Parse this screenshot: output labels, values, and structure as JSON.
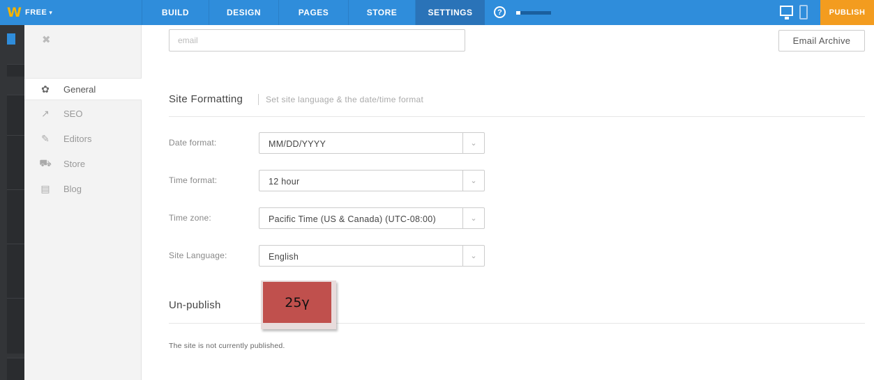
{
  "brand": {
    "logo": "W",
    "plan": "FREE",
    "plan_chevron": "▾"
  },
  "nav": {
    "tabs": [
      {
        "label": "BUILD"
      },
      {
        "label": "DESIGN"
      },
      {
        "label": "PAGES"
      },
      {
        "label": "STORE"
      },
      {
        "label": "SETTINGS",
        "active": true
      }
    ],
    "help_icon": "?",
    "progress_fraction": 0.12,
    "publish_label": "PUBLISH"
  },
  "sidebar": {
    "close_icon": "✖",
    "items": [
      {
        "label": "General",
        "icon": "gear-icon",
        "glyph": "✿",
        "active": true
      },
      {
        "label": "SEO",
        "icon": "trend-icon",
        "glyph": "↗"
      },
      {
        "label": "Editors",
        "icon": "pencil-icon",
        "glyph": "✎"
      },
      {
        "label": "Store",
        "icon": "cart-icon",
        "glyph": "⛟"
      },
      {
        "label": "Blog",
        "icon": "comment-icon",
        "glyph": "▤"
      }
    ]
  },
  "main": {
    "email_placeholder": "email",
    "email_archive_label": "Email Archive",
    "site_formatting": {
      "title": "Site Formatting",
      "subtitle": "Set site language & the date/time format",
      "fields": [
        {
          "label": "Date format:",
          "value": "MM/DD/YYYY"
        },
        {
          "label": "Time format:",
          "value": "12 hour"
        },
        {
          "label": "Time zone:",
          "value": "Pacific Time (US & Canada) (UTC-08:00)"
        },
        {
          "label": "Site Language:",
          "value": "English"
        }
      ]
    },
    "unpublish": {
      "title": "Un-publish",
      "status": "The site is not currently published."
    }
  },
  "overlay_badge": {
    "text": "25γ",
    "color": "#c0504d"
  },
  "colors": {
    "topbar": "#2f8ddb",
    "publish": "#f39c1f",
    "logo": "#f5b400"
  }
}
